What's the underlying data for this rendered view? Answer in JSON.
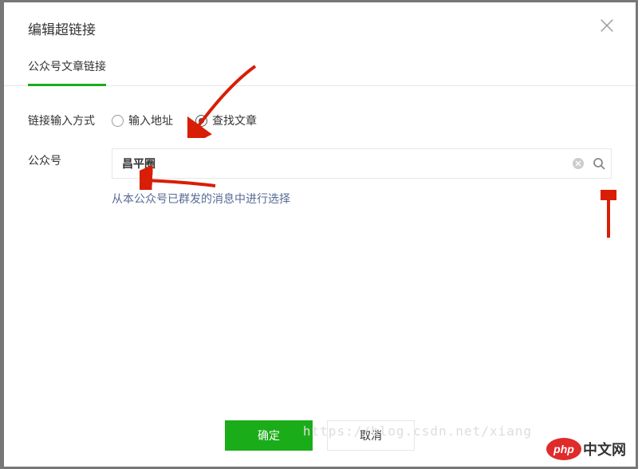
{
  "dialog": {
    "title": "编辑超链接",
    "tab_label": "公众号文章链接"
  },
  "form": {
    "method_label": "链接输入方式",
    "radio_url": "输入地址",
    "radio_search": "查找文章",
    "account_label": "公众号",
    "account_value": "昌平圈",
    "helper_link": "从本公众号已群发的消息中进行选择"
  },
  "footer": {
    "confirm": "确定",
    "cancel": "取消"
  },
  "watermark": {
    "text": "https://blog.csdn.net/xiang",
    "logo_php": "php",
    "logo_text": "中文网"
  }
}
